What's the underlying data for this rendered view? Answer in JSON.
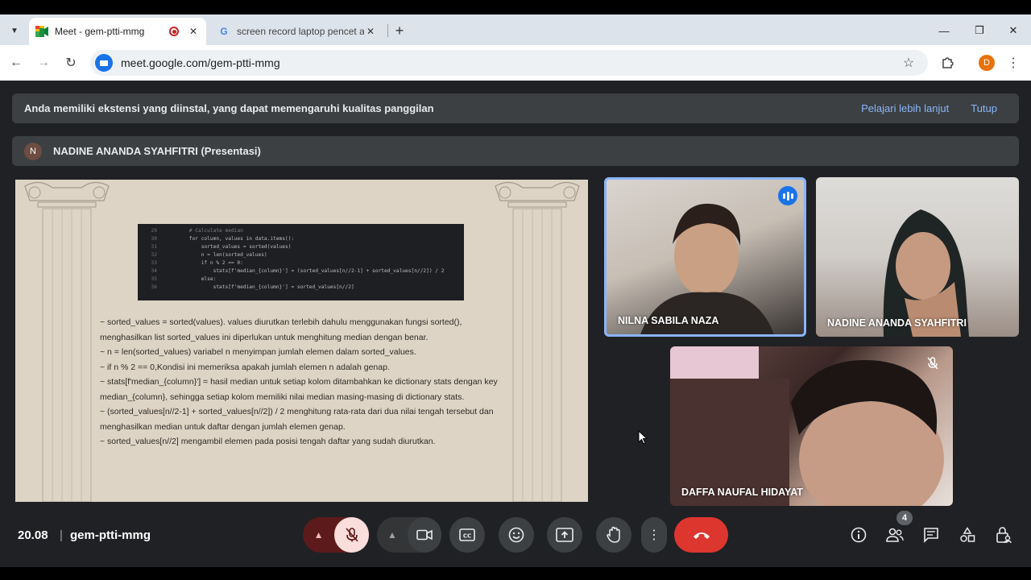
{
  "browser": {
    "tabs": [
      {
        "title": "Meet - gem-ptti-mmg",
        "active": true,
        "recording": true
      },
      {
        "title": "screen record laptop pencet ap",
        "active": false
      }
    ],
    "url": "meet.google.com/gem-ptti-mmg",
    "profile_initial": "D"
  },
  "banner": {
    "text": "Anda memiliki ekstensi yang diinstal, yang dapat memengaruhi kualitas panggilan",
    "learn_more": "Pelajari lebih lanjut",
    "close": "Tutup"
  },
  "presenter": {
    "initial": "N",
    "label": "NADINE ANANDA SYAHFITRI (Presentasi)"
  },
  "slide": {
    "code_lines": [
      {
        "n": "29",
        "t": "        # Calculate median",
        "comment": true
      },
      {
        "n": "30",
        "t": "        for column, values in data.items():"
      },
      {
        "n": "31",
        "t": "            sorted_values = sorted(values)"
      },
      {
        "n": "32",
        "t": "            n = len(sorted_values)"
      },
      {
        "n": "33",
        "t": "            if n % 2 == 0:"
      },
      {
        "n": "34",
        "t": "                stats[f'median_{column}'] = (sorted_values[n//2-1] + sorted_values[n//2]) / 2"
      },
      {
        "n": "35",
        "t": "            else:"
      },
      {
        "n": "36",
        "t": "                stats[f'median_{column}'] = sorted_values[n//2]"
      }
    ],
    "paragraphs": [
      "~  sorted_values = sorted(values). values diurutkan terlebih dahulu menggunakan fungsi sorted(), menghasilkan list sorted_values ini diperlukan untuk menghitung median dengan benar.",
      "~ n = len(sorted_values) variabel n menyimpan jumlah elemen dalam sorted_values.",
      "~ if n % 2 == 0,Kondisi ini memeriksa apakah jumlah elemen n adalah genap.",
      "~ stats[f'median_{column}'] = hasil median untuk setiap kolom ditambahkan ke dictionary stats dengan key median_{column}, sehingga setiap kolom memiliki nilai median masing-masing di dictionary stats.",
      "~ (sorted_values[n//2-1] + sorted_values[n//2]) / 2 menghitung rata-rata dari dua nilai tengah tersebut dan  menghasilkan median untuk daftar dengan jumlah elemen genap.",
      "~ sorted_values[n//2] mengambil elemen pada posisi tengah daftar yang sudah diurutkan."
    ]
  },
  "participants": [
    {
      "name": "NILNA SABILA NAZA",
      "speaking": true
    },
    {
      "name": "NADINE ANANDA SYAHFITRI",
      "speaking": false
    },
    {
      "name": "DAFFA NAUFAL HIDAYAT",
      "muted": true
    }
  ],
  "meeting": {
    "time": "20.08",
    "separator": "|",
    "code": "gem-ptti-mmg",
    "people_count": "4"
  },
  "colors": {
    "meet_bg": "#202124",
    "end_call": "#dc362e",
    "link": "#8ab4f8",
    "speaking_border": "#8ab4f8"
  }
}
